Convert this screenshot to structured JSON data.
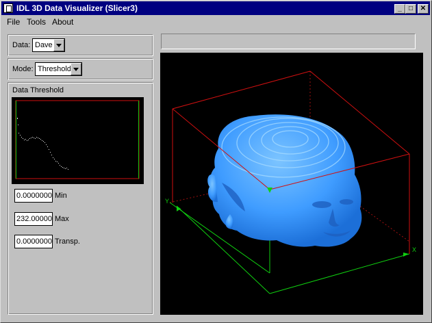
{
  "window": {
    "title": "IDL 3D Data Visualizer (Slicer3)"
  },
  "title_buttons": {
    "minimize": "_",
    "maximize": "□",
    "close": "✕"
  },
  "menu": {
    "items": [
      "File",
      "Tools",
      "About"
    ]
  },
  "data_panel": {
    "label": "Data:",
    "selected": "Dave"
  },
  "mode_panel": {
    "label": "Mode:",
    "selected": "Threshold"
  },
  "threshold_panel": {
    "title": "Data Threshold",
    "min_value": "0.0000000",
    "min_label": "Min",
    "max_value": "232.00000",
    "max_label": "Max",
    "transp_value": "0.0000000",
    "transp_label": "Transp."
  },
  "viewer": {
    "status_text": "",
    "axis_labels": {
      "y": "Y",
      "x": "X"
    },
    "colors": {
      "box_red": "#d01010",
      "box_green": "#10d010",
      "head": "#3f9cff",
      "background": "#000000"
    }
  }
}
